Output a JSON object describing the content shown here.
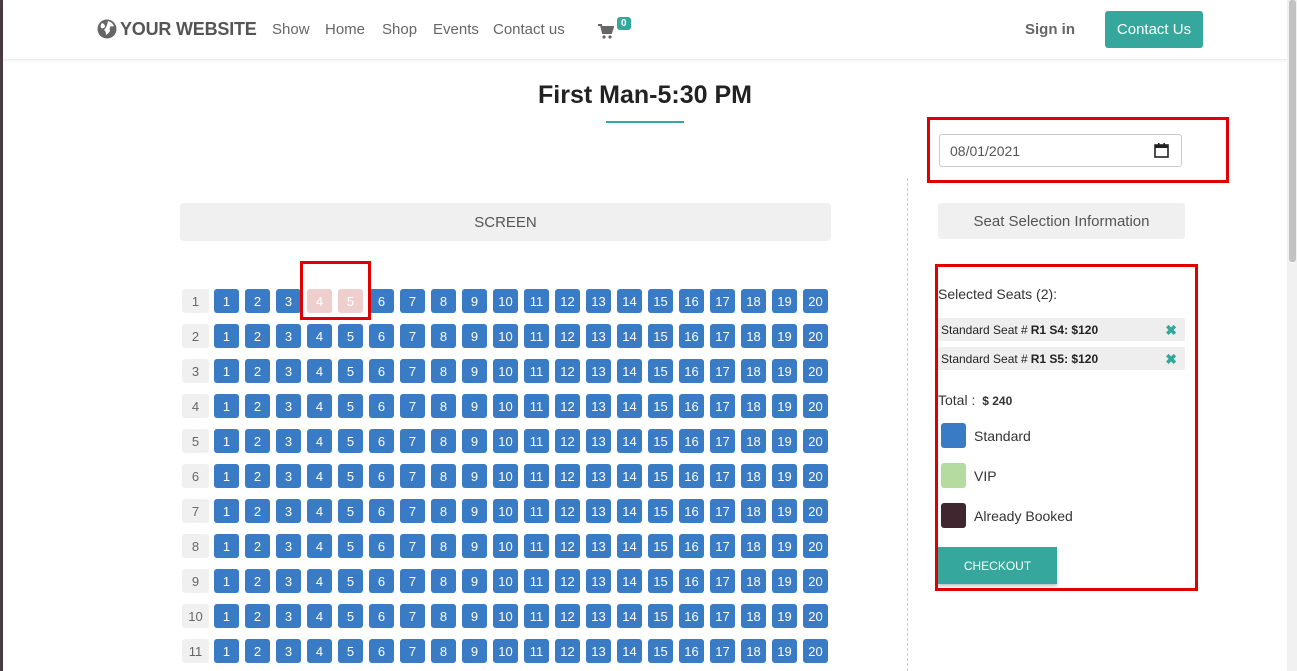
{
  "header": {
    "logo_text": "YOUR WEBSITE",
    "nav": [
      "Show",
      "Home",
      "Shop",
      "Events",
      "Contact us"
    ],
    "cart_count": "0",
    "signin_label": "Sign in",
    "contact_button": "Contact Us"
  },
  "page": {
    "title": "First Man-5:30 PM",
    "screen_label": "SCREEN",
    "date_value": "08/01/2021"
  },
  "seating": {
    "rows": [
      "1",
      "2",
      "3",
      "4",
      "5",
      "6",
      "7",
      "8",
      "9",
      "10",
      "11"
    ],
    "seats_per_row": [
      "1",
      "2",
      "3",
      "4",
      "5",
      "6",
      "7",
      "8",
      "9",
      "10",
      "11",
      "12",
      "13",
      "14",
      "15",
      "16",
      "17",
      "18",
      "19",
      "20"
    ],
    "selected": [
      {
        "row": "1",
        "seat": "4"
      },
      {
        "row": "1",
        "seat": "5"
      }
    ]
  },
  "sidebar": {
    "info_header": "Seat Selection Information",
    "selected_title": "Selected Seats (2):",
    "selected_items": [
      {
        "prefix": "Standard Seat #",
        "detail": "R1 S4: $120"
      },
      {
        "prefix": "Standard Seat #",
        "detail": "R1 S5: $120"
      }
    ],
    "total_label": "Total :",
    "total_value": "$ 240",
    "legend": [
      {
        "label": "Standard",
        "color": "#3a7bc6"
      },
      {
        "label": "VIP",
        "color": "#b6dba0"
      },
      {
        "label": "Already Booked",
        "color": "#40262f"
      }
    ],
    "checkout_label": "CHECKOUT"
  },
  "colors": {
    "accent": "#35a79c",
    "seat_standard": "#3a7bc6",
    "seat_selected": "#eecfce",
    "highlight_box": "#e00000"
  }
}
